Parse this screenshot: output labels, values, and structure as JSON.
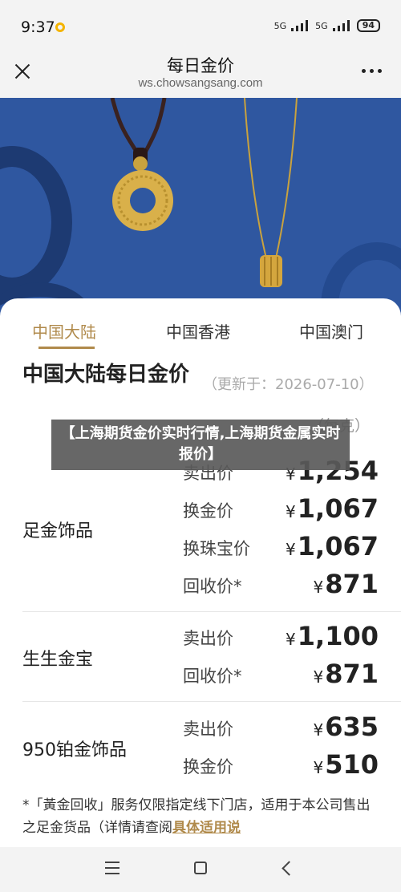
{
  "status": {
    "time": "9:37",
    "signal1": "5G",
    "signal2": "5G",
    "battery": "94"
  },
  "header": {
    "title": "每日金价",
    "url": "ws.chowsangsang.com"
  },
  "tabs": [
    "中国大陆",
    "中国香港",
    "中国澳门"
  ],
  "section": {
    "title": "中国大陆每日金价",
    "updated": "（更新于：2026-07-10）",
    "unit": "（每克）"
  },
  "currency": "¥",
  "products": [
    {
      "name": "足金饰品",
      "prices": [
        {
          "type": "卖出价",
          "value": "1,254"
        },
        {
          "type": "换金价",
          "value": "1,067"
        },
        {
          "type": "换珠宝价",
          "value": "1,067"
        },
        {
          "type": "回收价*",
          "value": "871"
        }
      ]
    },
    {
      "name": "生生金宝",
      "prices": [
        {
          "type": "卖出价",
          "value": "1,100"
        },
        {
          "type": "回收价*",
          "value": "871"
        }
      ]
    },
    {
      "name": "950铂金饰品",
      "prices": [
        {
          "type": "卖出价",
          "value": "635"
        },
        {
          "type": "换金价",
          "value": "510"
        }
      ]
    }
  ],
  "footnote": {
    "text": "*「黃金回收」服务仅限指定线下门店，适用于本公司售出之足金货品（详情请查阅",
    "link": "具体适用说"
  },
  "overlay": {
    "caption": "【上海期货金价实时行情,上海期货金属实时报价】"
  },
  "colors": {
    "accent": "#b08a4b",
    "hero_blue": "#2f57a0"
  },
  "icons": {
    "close": "close-icon",
    "more": "more-icon",
    "menu": "menu-icon",
    "home": "home-icon",
    "back": "back-icon"
  }
}
